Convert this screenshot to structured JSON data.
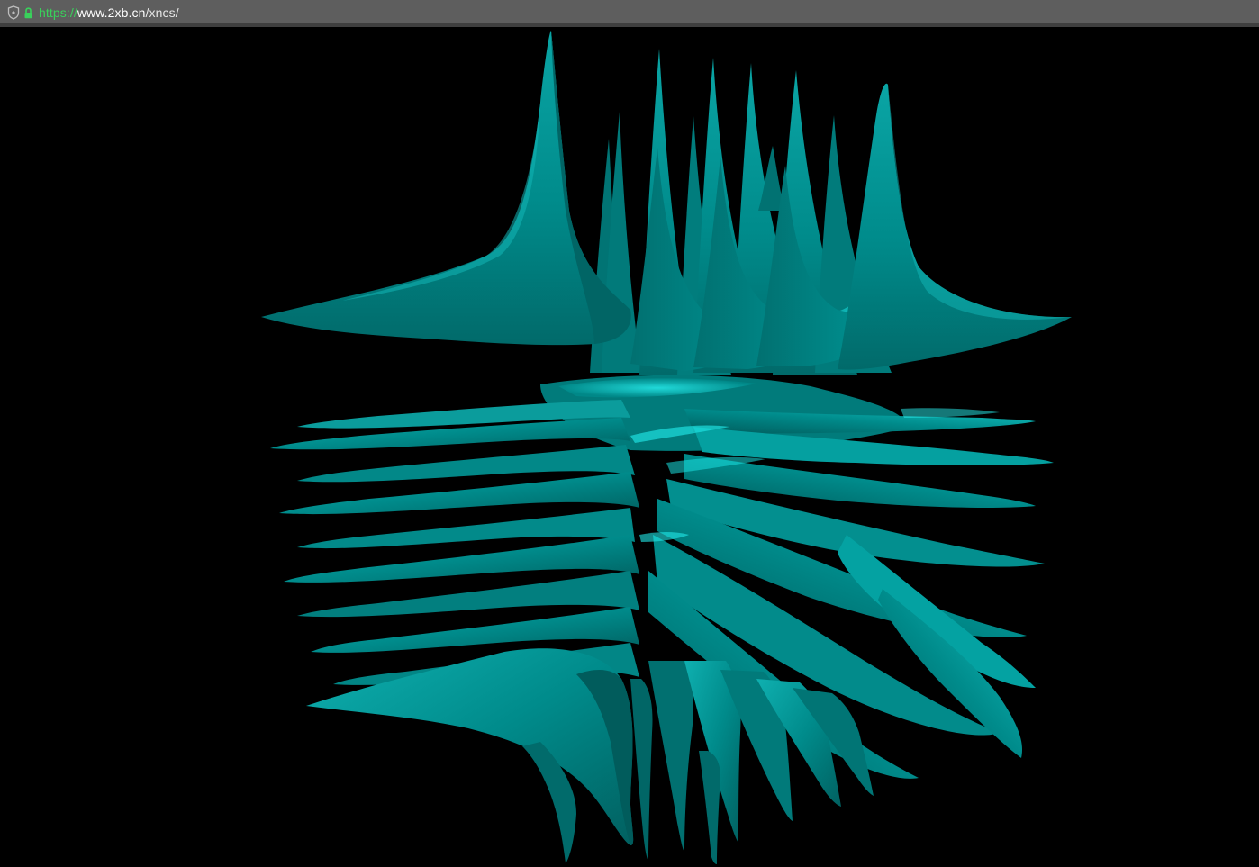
{
  "browser": {
    "url_scheme": "https://",
    "url_host": "www.2xb.cn",
    "url_path": "/xncs/"
  },
  "scene": {
    "background_color": "#000000",
    "surface_color": "#008b8b",
    "highlight_color": "#19e6e6",
    "shadow_color": "#015e5e"
  }
}
